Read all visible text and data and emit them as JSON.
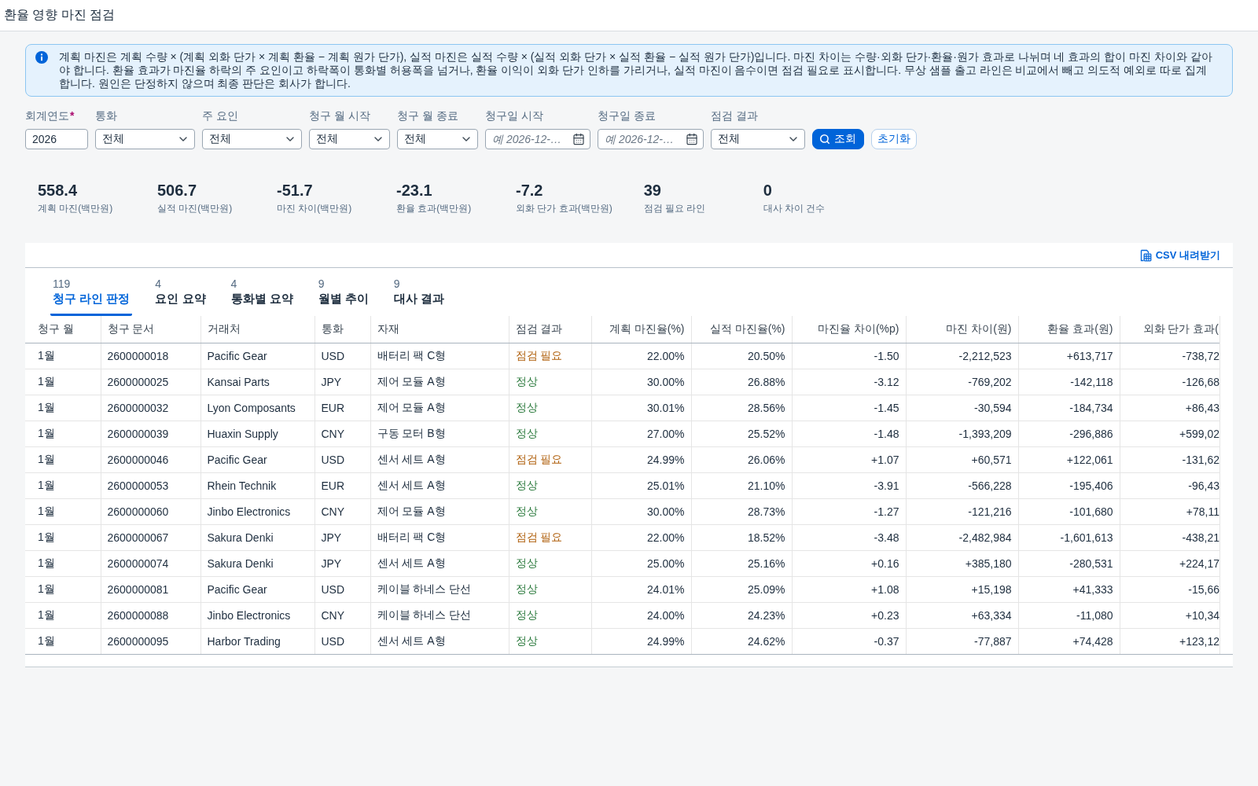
{
  "window": {
    "title": "환율 영향 마진 점검"
  },
  "notice": {
    "text": "계획 마진은 계획 수량 × (계획 외화 단가 × 계획 환율 − 계획 원가 단가), 실적 마진은 실적 수량 × (실적 외화 단가 × 실적 환율 − 실적 원가 단가)입니다. 마진 차이는 수량·외화 단가·환율·원가 효과로 나뉘며 네 효과의 합이 마진 차이와 같아야 합니다. 환율 효과가 마진율 하락의 주 요인이고 하락폭이 통화별 허용폭을 넘거나, 환율 이익이 외화 단가 인하를 가리거나, 실적 마진이 음수이면 점검 필요로 표시합니다. 무상 샘플 출고 라인은 비교에서 빼고 의도적 예외로 따로 집계합니다. 원인은 단정하지 않으며 최종 판단은 회사가 합니다."
  },
  "filters": [
    {
      "kind": "text",
      "label": "회계연도",
      "required_mark": "*",
      "value": "2026"
    },
    {
      "kind": "select",
      "label": "통화",
      "value": "전체"
    },
    {
      "kind": "select",
      "label": "주 요인",
      "value": "전체"
    },
    {
      "kind": "select",
      "label": "청구 월 시작",
      "value": "전체"
    },
    {
      "kind": "select",
      "label": "청구 월 종료",
      "value": "전체"
    },
    {
      "kind": "date",
      "label": "청구일 시작",
      "placeholder": "예 2026-12-…"
    },
    {
      "kind": "date",
      "label": "청구일 종료",
      "placeholder": "예 2026-12-…"
    },
    {
      "kind": "select",
      "label": "점검 결과",
      "value": "전체"
    }
  ],
  "actions": [
    {
      "kind": "primary",
      "label": "조회"
    },
    {
      "kind": "secondary",
      "label": "초기화"
    }
  ],
  "kpis": [
    {
      "value": "558.4",
      "label": "계획 마진(백만원)"
    },
    {
      "value": "506.7",
      "label": "실적 마진(백만원)"
    },
    {
      "value": "-51.7",
      "label": "마진 차이(백만원)"
    },
    {
      "value": "-23.1",
      "label": "환율 효과(백만원)"
    },
    {
      "value": "-7.2",
      "label": "외화 단가 효과(백만원)"
    },
    {
      "value": "39",
      "label": "점검 필요 라인"
    },
    {
      "value": "0",
      "label": "대사 차이 건수"
    }
  ],
  "results": {
    "download": {
      "label": "CSV 내려받기"
    },
    "tabs": [
      {
        "count": "119",
        "label": "청구 라인 판정",
        "selected": true
      },
      {
        "count": "4",
        "label": "요인 요약",
        "selected": false
      },
      {
        "count": "4",
        "label": "통화별 요약",
        "selected": false
      },
      {
        "count": "9",
        "label": "월별 추이",
        "selected": false
      },
      {
        "count": "9",
        "label": "대사 결과",
        "selected": false
      }
    ],
    "table": {
      "columns": [
        {
          "label": "청구 월",
          "kind": "text"
        },
        {
          "label": "청구 문서",
          "kind": "text"
        },
        {
          "label": "거래처",
          "kind": "text"
        },
        {
          "label": "통화",
          "kind": "text"
        },
        {
          "label": "자재",
          "kind": "text"
        },
        {
          "label": "점검 결과",
          "kind": "status"
        },
        {
          "label": "계획 마진율(%)",
          "kind": "number"
        },
        {
          "label": "실적 마진율(%)",
          "kind": "number"
        },
        {
          "label": "마진율 차이(%p)",
          "kind": "number"
        },
        {
          "label": "마진 차이(원)",
          "kind": "number"
        },
        {
          "label": "환율 효과(원)",
          "kind": "number"
        },
        {
          "label": "외화 단가 효과(",
          "kind": "number"
        }
      ],
      "rows": [
        {
          "needs_check": true,
          "cells": [
            "1월",
            "2600000018",
            "Pacific Gear",
            "USD",
            "배터리 팩 C형",
            "점검 필요",
            "22.00%",
            "20.50%",
            "-1.50",
            "-2,212,523",
            "+613,717",
            "-738,72"
          ]
        },
        {
          "needs_check": false,
          "cells": [
            "1월",
            "2600000025",
            "Kansai Parts",
            "JPY",
            "제어 모듈 A형",
            "정상",
            "30.00%",
            "26.88%",
            "-3.12",
            "-769,202",
            "-142,118",
            "-126,68"
          ]
        },
        {
          "needs_check": false,
          "cells": [
            "1월",
            "2600000032",
            "Lyon Composants",
            "EUR",
            "제어 모듈 A형",
            "정상",
            "30.01%",
            "28.56%",
            "-1.45",
            "-30,594",
            "-184,734",
            "+86,43"
          ]
        },
        {
          "needs_check": false,
          "cells": [
            "1월",
            "2600000039",
            "Huaxin Supply",
            "CNY",
            "구동 모터 B형",
            "정상",
            "27.00%",
            "25.52%",
            "-1.48",
            "-1,393,209",
            "-296,886",
            "+599,02"
          ]
        },
        {
          "needs_check": true,
          "cells": [
            "1월",
            "2600000046",
            "Pacific Gear",
            "USD",
            "센서 세트 A형",
            "점검 필요",
            "24.99%",
            "26.06%",
            "+1.07",
            "+60,571",
            "+122,061",
            "-131,62"
          ]
        },
        {
          "needs_check": false,
          "cells": [
            "1월",
            "2600000053",
            "Rhein Technik",
            "EUR",
            "센서 세트 A형",
            "정상",
            "25.01%",
            "21.10%",
            "-3.91",
            "-566,228",
            "-195,406",
            "-96,43"
          ]
        },
        {
          "needs_check": false,
          "cells": [
            "1월",
            "2600000060",
            "Jinbo Electronics",
            "CNY",
            "제어 모듈 A형",
            "정상",
            "30.00%",
            "28.73%",
            "-1.27",
            "-121,216",
            "-101,680",
            "+78,11"
          ]
        },
        {
          "needs_check": true,
          "cells": [
            "1월",
            "2600000067",
            "Sakura Denki",
            "JPY",
            "배터리 팩 C형",
            "점검 필요",
            "22.00%",
            "18.52%",
            "-3.48",
            "-2,482,984",
            "-1,601,613",
            "-438,21"
          ]
        },
        {
          "needs_check": false,
          "cells": [
            "1월",
            "2600000074",
            "Sakura Denki",
            "JPY",
            "센서 세트 A형",
            "정상",
            "25.00%",
            "25.16%",
            "+0.16",
            "+385,180",
            "-280,531",
            "+224,17"
          ]
        },
        {
          "needs_check": false,
          "cells": [
            "1월",
            "2600000081",
            "Pacific Gear",
            "USD",
            "케이블 하네스 단선",
            "정상",
            "24.01%",
            "25.09%",
            "+1.08",
            "+15,198",
            "+41,333",
            "-15,66"
          ]
        },
        {
          "needs_check": false,
          "cells": [
            "1월",
            "2600000088",
            "Jinbo Electronics",
            "CNY",
            "케이블 하네스 단선",
            "정상",
            "24.00%",
            "24.23%",
            "+0.23",
            "+63,334",
            "-11,080",
            "+10,34"
          ]
        },
        {
          "needs_check": false,
          "cells": [
            "1월",
            "2600000095",
            "Harbor Trading",
            "USD",
            "센서 세트 A형",
            "정상",
            "24.99%",
            "24.62%",
            "-0.37",
            "-77,887",
            "+74,428",
            "+123,12"
          ]
        }
      ]
    }
  }
}
